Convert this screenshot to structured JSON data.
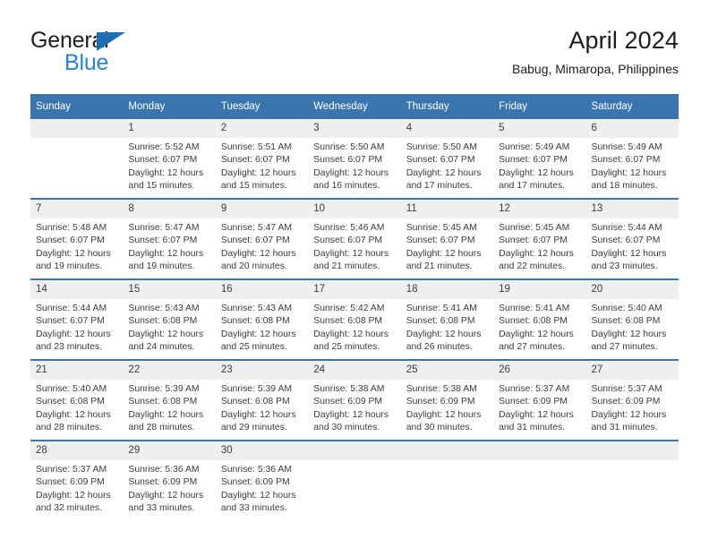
{
  "brand": {
    "line1": "General",
    "line2": "Blue",
    "triangle_color": "#1f6db5",
    "blue_text_color": "#2585d3"
  },
  "header": {
    "title": "April 2024",
    "subtitle": "Babug, Mimaropa, Philippines"
  },
  "colors": {
    "header_blue": "#3a75b0",
    "daynum_band": "#efefef",
    "text": "#3c3c3b"
  },
  "weekday_headers": [
    "Sunday",
    "Monday",
    "Tuesday",
    "Wednesday",
    "Thursday",
    "Friday",
    "Saturday"
  ],
  "weeks": [
    [
      {
        "day": "",
        "sunrise": "",
        "sunset": "",
        "daylight1": "",
        "daylight2": ""
      },
      {
        "day": "1",
        "sunrise": "Sunrise: 5:52 AM",
        "sunset": "Sunset: 6:07 PM",
        "daylight1": "Daylight: 12 hours",
        "daylight2": "and 15 minutes."
      },
      {
        "day": "2",
        "sunrise": "Sunrise: 5:51 AM",
        "sunset": "Sunset: 6:07 PM",
        "daylight1": "Daylight: 12 hours",
        "daylight2": "and 15 minutes."
      },
      {
        "day": "3",
        "sunrise": "Sunrise: 5:50 AM",
        "sunset": "Sunset: 6:07 PM",
        "daylight1": "Daylight: 12 hours",
        "daylight2": "and 16 minutes."
      },
      {
        "day": "4",
        "sunrise": "Sunrise: 5:50 AM",
        "sunset": "Sunset: 6:07 PM",
        "daylight1": "Daylight: 12 hours",
        "daylight2": "and 17 minutes."
      },
      {
        "day": "5",
        "sunrise": "Sunrise: 5:49 AM",
        "sunset": "Sunset: 6:07 PM",
        "daylight1": "Daylight: 12 hours",
        "daylight2": "and 17 minutes."
      },
      {
        "day": "6",
        "sunrise": "Sunrise: 5:49 AM",
        "sunset": "Sunset: 6:07 PM",
        "daylight1": "Daylight: 12 hours",
        "daylight2": "and 18 minutes."
      }
    ],
    [
      {
        "day": "7",
        "sunrise": "Sunrise: 5:48 AM",
        "sunset": "Sunset: 6:07 PM",
        "daylight1": "Daylight: 12 hours",
        "daylight2": "and 19 minutes."
      },
      {
        "day": "8",
        "sunrise": "Sunrise: 5:47 AM",
        "sunset": "Sunset: 6:07 PM",
        "daylight1": "Daylight: 12 hours",
        "daylight2": "and 19 minutes."
      },
      {
        "day": "9",
        "sunrise": "Sunrise: 5:47 AM",
        "sunset": "Sunset: 6:07 PM",
        "daylight1": "Daylight: 12 hours",
        "daylight2": "and 20 minutes."
      },
      {
        "day": "10",
        "sunrise": "Sunrise: 5:46 AM",
        "sunset": "Sunset: 6:07 PM",
        "daylight1": "Daylight: 12 hours",
        "daylight2": "and 21 minutes."
      },
      {
        "day": "11",
        "sunrise": "Sunrise: 5:45 AM",
        "sunset": "Sunset: 6:07 PM",
        "daylight1": "Daylight: 12 hours",
        "daylight2": "and 21 minutes."
      },
      {
        "day": "12",
        "sunrise": "Sunrise: 5:45 AM",
        "sunset": "Sunset: 6:07 PM",
        "daylight1": "Daylight: 12 hours",
        "daylight2": "and 22 minutes."
      },
      {
        "day": "13",
        "sunrise": "Sunrise: 5:44 AM",
        "sunset": "Sunset: 6:07 PM",
        "daylight1": "Daylight: 12 hours",
        "daylight2": "and 23 minutes."
      }
    ],
    [
      {
        "day": "14",
        "sunrise": "Sunrise: 5:44 AM",
        "sunset": "Sunset: 6:07 PM",
        "daylight1": "Daylight: 12 hours",
        "daylight2": "and 23 minutes."
      },
      {
        "day": "15",
        "sunrise": "Sunrise: 5:43 AM",
        "sunset": "Sunset: 6:08 PM",
        "daylight1": "Daylight: 12 hours",
        "daylight2": "and 24 minutes."
      },
      {
        "day": "16",
        "sunrise": "Sunrise: 5:43 AM",
        "sunset": "Sunset: 6:08 PM",
        "daylight1": "Daylight: 12 hours",
        "daylight2": "and 25 minutes."
      },
      {
        "day": "17",
        "sunrise": "Sunrise: 5:42 AM",
        "sunset": "Sunset: 6:08 PM",
        "daylight1": "Daylight: 12 hours",
        "daylight2": "and 25 minutes."
      },
      {
        "day": "18",
        "sunrise": "Sunrise: 5:41 AM",
        "sunset": "Sunset: 6:08 PM",
        "daylight1": "Daylight: 12 hours",
        "daylight2": "and 26 minutes."
      },
      {
        "day": "19",
        "sunrise": "Sunrise: 5:41 AM",
        "sunset": "Sunset: 6:08 PM",
        "daylight1": "Daylight: 12 hours",
        "daylight2": "and 27 minutes."
      },
      {
        "day": "20",
        "sunrise": "Sunrise: 5:40 AM",
        "sunset": "Sunset: 6:08 PM",
        "daylight1": "Daylight: 12 hours",
        "daylight2": "and 27 minutes."
      }
    ],
    [
      {
        "day": "21",
        "sunrise": "Sunrise: 5:40 AM",
        "sunset": "Sunset: 6:08 PM",
        "daylight1": "Daylight: 12 hours",
        "daylight2": "and 28 minutes."
      },
      {
        "day": "22",
        "sunrise": "Sunrise: 5:39 AM",
        "sunset": "Sunset: 6:08 PM",
        "daylight1": "Daylight: 12 hours",
        "daylight2": "and 28 minutes."
      },
      {
        "day": "23",
        "sunrise": "Sunrise: 5:39 AM",
        "sunset": "Sunset: 6:08 PM",
        "daylight1": "Daylight: 12 hours",
        "daylight2": "and 29 minutes."
      },
      {
        "day": "24",
        "sunrise": "Sunrise: 5:38 AM",
        "sunset": "Sunset: 6:09 PM",
        "daylight1": "Daylight: 12 hours",
        "daylight2": "and 30 minutes."
      },
      {
        "day": "25",
        "sunrise": "Sunrise: 5:38 AM",
        "sunset": "Sunset: 6:09 PM",
        "daylight1": "Daylight: 12 hours",
        "daylight2": "and 30 minutes."
      },
      {
        "day": "26",
        "sunrise": "Sunrise: 5:37 AM",
        "sunset": "Sunset: 6:09 PM",
        "daylight1": "Daylight: 12 hours",
        "daylight2": "and 31 minutes."
      },
      {
        "day": "27",
        "sunrise": "Sunrise: 5:37 AM",
        "sunset": "Sunset: 6:09 PM",
        "daylight1": "Daylight: 12 hours",
        "daylight2": "and 31 minutes."
      }
    ],
    [
      {
        "day": "28",
        "sunrise": "Sunrise: 5:37 AM",
        "sunset": "Sunset: 6:09 PM",
        "daylight1": "Daylight: 12 hours",
        "daylight2": "and 32 minutes."
      },
      {
        "day": "29",
        "sunrise": "Sunrise: 5:36 AM",
        "sunset": "Sunset: 6:09 PM",
        "daylight1": "Daylight: 12 hours",
        "daylight2": "and 33 minutes."
      },
      {
        "day": "30",
        "sunrise": "Sunrise: 5:36 AM",
        "sunset": "Sunset: 6:09 PM",
        "daylight1": "Daylight: 12 hours",
        "daylight2": "and 33 minutes."
      },
      {
        "day": "",
        "sunrise": "",
        "sunset": "",
        "daylight1": "",
        "daylight2": ""
      },
      {
        "day": "",
        "sunrise": "",
        "sunset": "",
        "daylight1": "",
        "daylight2": ""
      },
      {
        "day": "",
        "sunrise": "",
        "sunset": "",
        "daylight1": "",
        "daylight2": ""
      },
      {
        "day": "",
        "sunrise": "",
        "sunset": "",
        "daylight1": "",
        "daylight2": ""
      }
    ]
  ]
}
